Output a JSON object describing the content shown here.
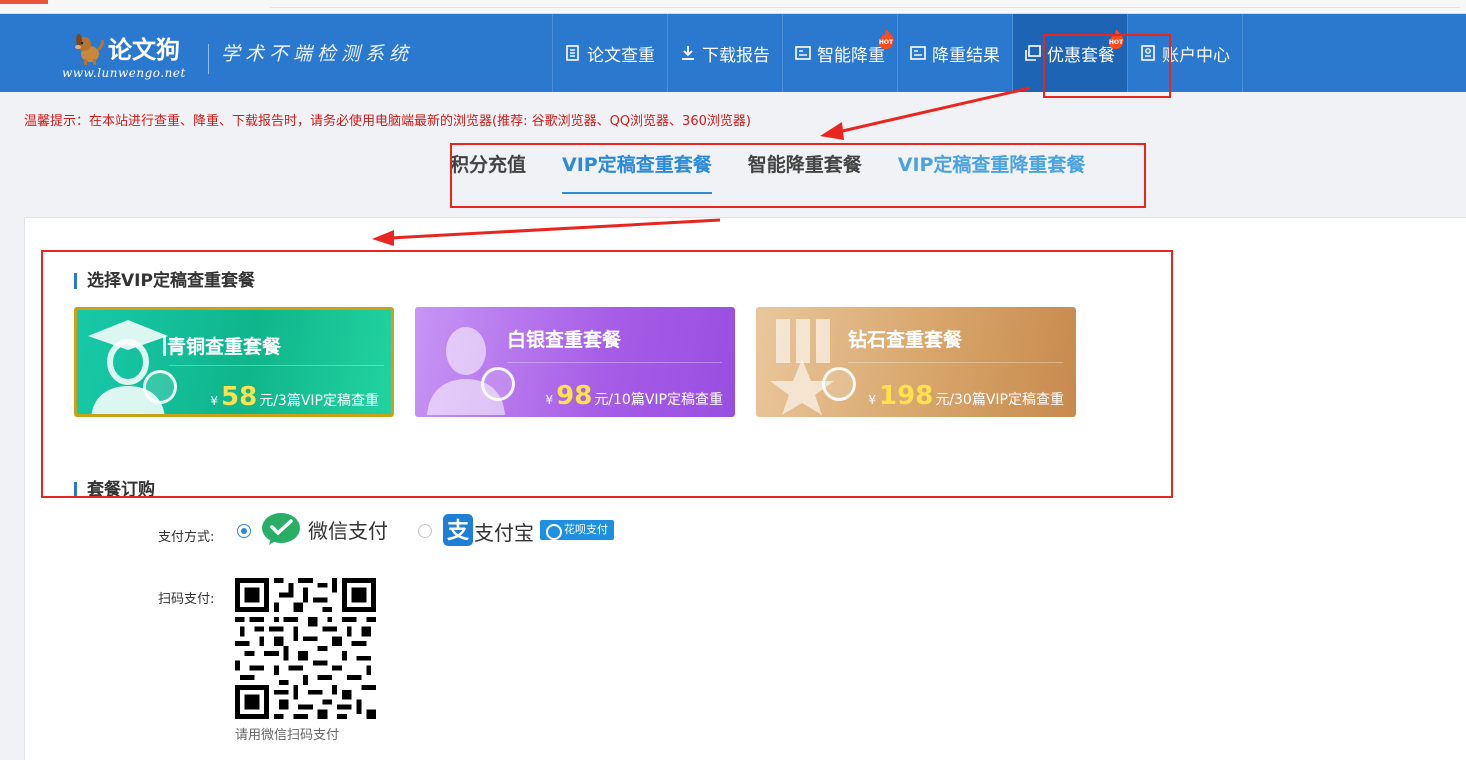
{
  "site": {
    "logo_title": "论文狗",
    "logo_url": "www.lunwengo.net",
    "slogan": "学术不端检测系统"
  },
  "nav": {
    "items": [
      {
        "label": "论文查重",
        "icon": "document-icon",
        "hot": false,
        "active": false
      },
      {
        "label": "下载报告",
        "icon": "download-icon",
        "hot": false,
        "active": false
      },
      {
        "label": "智能降重",
        "icon": "reduce-icon",
        "hot": true,
        "active": false
      },
      {
        "label": "降重结果",
        "icon": "result-icon",
        "hot": false,
        "active": false
      },
      {
        "label": "优惠套餐",
        "icon": "package-icon",
        "hot": true,
        "active": true
      },
      {
        "label": "账户中心",
        "icon": "account-icon",
        "hot": false,
        "active": false
      }
    ],
    "hot_badge": "HOT"
  },
  "notice": "温馨提示：在本站进行查重、降重、下载报告时，请务必使用电脑端最新的浏览器(推荐: 谷歌浏览器、QQ浏览器、360浏览器)",
  "tabs": [
    {
      "label": "积分充值",
      "active": false
    },
    {
      "label": "VIP定稿查重套餐",
      "active": true
    },
    {
      "label": "智能降重套餐",
      "active": false
    },
    {
      "label": "VIP定稿查重降重套餐",
      "active": false
    }
  ],
  "package_section": {
    "title": "选择VIP定稿查重套餐",
    "currency": "¥",
    "cards": [
      {
        "title": "青铜查重套餐",
        "price": "58",
        "desc": "元/3篇VIP定稿查重",
        "selected": true
      },
      {
        "title": "白银查重套餐",
        "price": "98",
        "desc": "元/10篇VIP定稿查重",
        "selected": false
      },
      {
        "title": "钻石查重套餐",
        "price": "198",
        "desc": "元/30篇VIP定稿查重",
        "selected": false
      }
    ]
  },
  "order_section": {
    "title": "套餐订购",
    "payment_label": "支付方式:",
    "wechat_label": "微信支付",
    "alipay_label": "支付宝",
    "huabei_label": "花呗支付",
    "selected_method": "wechat",
    "qr_label": "扫码支付:",
    "qr_caption": "请用微信扫码支付"
  },
  "colors": {
    "header": "#2b78cf",
    "accent": "#2b8ad9",
    "notice": "#d01b1b",
    "annotation": "#e8261f"
  }
}
